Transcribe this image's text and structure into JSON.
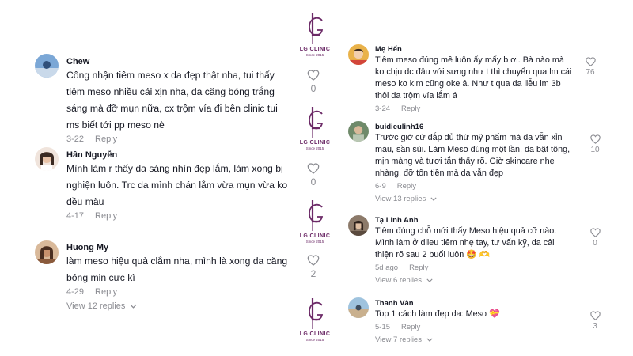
{
  "brand": {
    "name": "LG CLINIC",
    "since": "Since 2015",
    "color": "#6c2a67"
  },
  "colors": {
    "text": "#161823",
    "muted": "#8a8b91"
  },
  "left_comments": [
    {
      "username": "Chew",
      "lines": [
        "Công nhận tiêm meso x da đẹp thật nha, tui thấy",
        "tiêm meso nhiều cái xịn nha, da căng bóng trắng",
        "sáng mà đỡ mụn nữa, cx trộm vía đi bên clinic tui",
        "ms biết tới pp meso nè"
      ],
      "date": "3-22",
      "reply": "Reply",
      "likes": "0"
    },
    {
      "username": "Hân Nguyễn",
      "lines": [
        "Mình làm r thấy da sáng nhìn đẹp lắm, làm xong bị",
        "nghiện luôn. Trc da mình chán lắm vừa mụn vừa ko",
        "đều màu"
      ],
      "date": "4-17",
      "reply": "Reply",
      "likes": "0"
    },
    {
      "username": "Huong My",
      "lines": [
        "làm meso hiệu quả clắm nha, mình là xong da căng",
        "bóng mịn cực kì"
      ],
      "date": "4-29",
      "reply": "Reply",
      "likes": "2",
      "view_replies": "View 12 replies"
    }
  ],
  "right_comments": [
    {
      "username": "Mẹ Hến",
      "lines": [
        "Tiêm meso đúng mê luôn ấy mấy b ơi. Bà nào mà",
        "ko chịu dc đâu với sưng như t thì chuyển qua lm cái",
        "meso ko kim cũng oke á. Như t qua da liễu lm 3b",
        "thôi da trộm vía lắm á"
      ],
      "date": "3-24",
      "reply": "Reply",
      "likes": "76"
    },
    {
      "username": "buidieulinh16",
      "lines": [
        "Trước giờ cứ đắp dủ thứ mỹ phẩm mà da vẫn xỉn",
        "màu, sần sùi. Làm Meso đúng một lần, da bật tông,",
        "mịn màng và tươi tắn thấy rõ. Giờ skincare nhẹ",
        "nhàng, đỡ tốn tiền mà da vẫn đẹp"
      ],
      "date": "6-9",
      "reply": "Reply",
      "likes": "10",
      "view_replies": "View 13 replies"
    },
    {
      "username": "Tạ Linh Anh",
      "lines": [
        "Tiêm đúng chỗ mới thấy Meso hiệu quả cỡ nào.",
        "Mình làm ở dlieu tiêm nhẹ tay, tư vấn kỹ, da cải",
        "thiện rõ sau 2 buổi luôn 🤩 🫶"
      ],
      "date": "5d ago",
      "reply": "Reply",
      "likes": "0",
      "view_replies": "View 6 replies"
    },
    {
      "username": "Thanh Vân",
      "lines": [
        "Top 1 cách làm đẹp da: Meso 💝"
      ],
      "date": "5-15",
      "reply": "Reply",
      "likes": "3",
      "view_replies": "View 7 replies"
    }
  ]
}
